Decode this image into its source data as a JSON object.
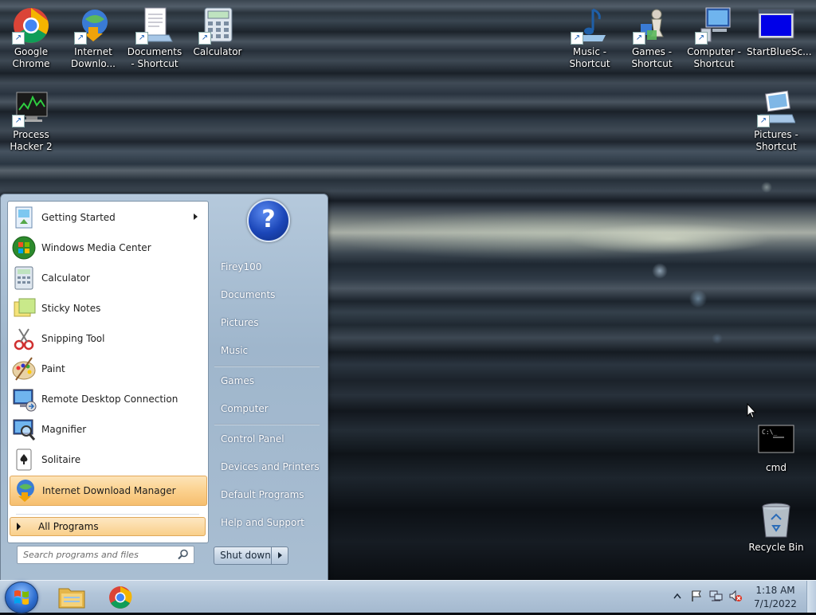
{
  "desktop": {
    "icons_left": [
      {
        "label": "Google Chrome",
        "icon": "chrome-icon"
      },
      {
        "label": "Internet Downlo...",
        "icon": "idm-icon"
      },
      {
        "label": "Documents - Shortcut",
        "icon": "documents-icon"
      },
      {
        "label": "Calculator",
        "icon": "calculator-icon"
      },
      {
        "label": "Process Hacker 2",
        "icon": "process-hacker-icon"
      }
    ],
    "icons_right": [
      {
        "label": "Music - Shortcut",
        "icon": "music-icon"
      },
      {
        "label": "Games - Shortcut",
        "icon": "games-icon"
      },
      {
        "label": "Computer - Shortcut",
        "icon": "computer-icon"
      },
      {
        "label": "StartBlueSc...",
        "icon": "blue-screen-icon"
      },
      {
        "label": "Pictures - Shortcut",
        "icon": "pictures-icon"
      },
      {
        "label": "cmd",
        "icon": "cmd-icon"
      },
      {
        "label": "Recycle Bin",
        "icon": "recycle-bin-icon"
      }
    ]
  },
  "start_menu": {
    "pinned": [
      {
        "label": "Getting Started",
        "has_submenu": true
      },
      {
        "label": "Windows Media Center"
      },
      {
        "label": "Calculator"
      },
      {
        "label": "Sticky Notes"
      },
      {
        "label": "Snipping Tool"
      },
      {
        "label": "Paint"
      },
      {
        "label": "Remote Desktop Connection"
      },
      {
        "label": "Magnifier"
      },
      {
        "label": "Solitaire"
      },
      {
        "label": "Internet Download Manager",
        "highlighted": true
      }
    ],
    "all_programs": "All Programs",
    "search_placeholder": "Search programs and files",
    "right_items": [
      "Firey100",
      "Documents",
      "Pictures",
      "Music",
      "Games",
      "Computer",
      "Control Panel",
      "Devices and Printers",
      "Default Programs",
      "Help and Support"
    ],
    "help_glyph": "?",
    "shutdown": "Shut down"
  },
  "taskbar": {
    "pinned": [
      "explorer-icon",
      "chrome-icon"
    ],
    "tray_icons": [
      "show-hidden-icon",
      "action-center-flag-icon",
      "network-icon",
      "volume-muted-icon"
    ],
    "clock_time": "1:18 AM",
    "clock_date": "7/1/2022"
  },
  "colors": {
    "menu_highlight": "#fbd18e",
    "taskbar": "#b2c5d9",
    "menu_right_panel": "#9fb6cc"
  }
}
